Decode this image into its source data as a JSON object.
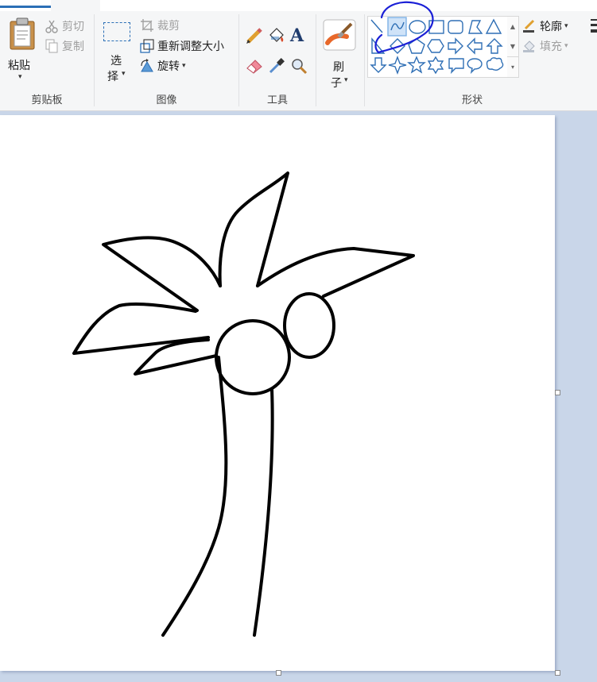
{
  "clipboard": {
    "paste_label": "粘贴",
    "cut_label": "剪切",
    "copy_label": "复制",
    "group_label": "剪贴板"
  },
  "image": {
    "select_label_1": "选",
    "select_label_2": "择",
    "crop_label": "裁剪",
    "resize_label": "重新调整大小",
    "rotate_label": "旋转",
    "group_label": "图像"
  },
  "tools": {
    "group_label": "工具",
    "text_tool_glyph": "A"
  },
  "brushes": {
    "label_1": "刷",
    "label_2": "子"
  },
  "shapes": {
    "group_label": "形状",
    "outline_label": "轮廓",
    "fill_label": "填充",
    "selected_shape": "curve-shape"
  },
  "colors": {
    "accent": "#2b6fb6",
    "shape_stroke": "#2f6fb5",
    "annotation": "#1a1fd6"
  }
}
